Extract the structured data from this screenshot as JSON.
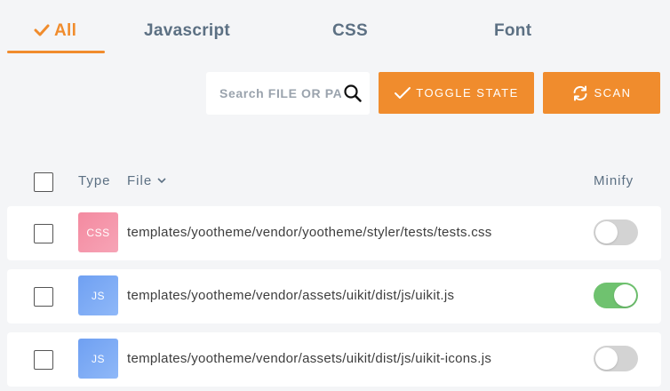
{
  "tabs": [
    {
      "label": "All",
      "active": true,
      "icon": "check-icon"
    },
    {
      "label": "Javascript",
      "active": false
    },
    {
      "label": "CSS",
      "active": false
    },
    {
      "label": "Font",
      "active": false
    }
  ],
  "search": {
    "placeholder": "Search FILE OR PATH",
    "value": ""
  },
  "toolbar": {
    "toggle_label": "TOGGLE STATE",
    "scan_label": "SCAN"
  },
  "table": {
    "headers": {
      "type": "Type",
      "file": "File",
      "minify": "Minify"
    },
    "sort_icon": "chevron-down-icon",
    "rows": [
      {
        "type": "CSS",
        "path": "templates/yootheme/vendor/yootheme/styler/tests/tests.css",
        "minify": false,
        "checked": false
      },
      {
        "type": "JS",
        "path": "templates/yootheme/vendor/assets/uikit/dist/js/uikit.js",
        "minify": true,
        "checked": false
      },
      {
        "type": "JS",
        "path": "templates/yootheme/vendor/assets/uikit/dist/js/uikit-icons.js",
        "minify": false,
        "checked": false
      }
    ]
  },
  "colors": {
    "accent": "#f08c2d",
    "toggle_on": "#6fc26f",
    "toggle_off": "#d3d3d3",
    "css_badge": "#f48aa0",
    "js_badge": "#6fa0f2"
  }
}
